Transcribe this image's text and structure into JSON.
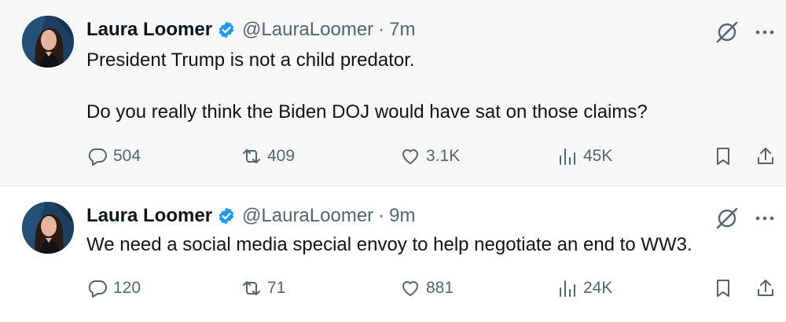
{
  "tweets": [
    {
      "author_name": "Laura Loomer",
      "handle": "@LauraLoomer",
      "separator": "·",
      "time": "7m",
      "lines": [
        "President Trump is not a child predator.",
        "Do you really think the Biden DOJ would have sat on those claims?"
      ],
      "stats": {
        "replies": "504",
        "reposts": "409",
        "likes": "3.1K",
        "views": "45K"
      }
    },
    {
      "author_name": "Laura Loomer",
      "handle": "@LauraLoomer",
      "separator": "·",
      "time": "9m",
      "lines": [
        "We need a social media special envoy to help negotiate an end to WW3."
      ],
      "stats": {
        "replies": "120",
        "reposts": "71",
        "likes": "881",
        "views": "24K"
      }
    }
  ],
  "icons": {
    "verified": "verified-badge-icon",
    "grok": "grok-icon",
    "more": "more-icon",
    "reply": "reply-icon",
    "repost": "repost-icon",
    "like": "heart-icon",
    "views": "views-icon",
    "bookmark": "bookmark-icon",
    "share": "share-icon"
  },
  "colors": {
    "verified_blue": "#1d9bf0",
    "secondary_text": "#536471",
    "primary_text": "#0f1419",
    "highlighted_background": "#f7f7f7"
  }
}
